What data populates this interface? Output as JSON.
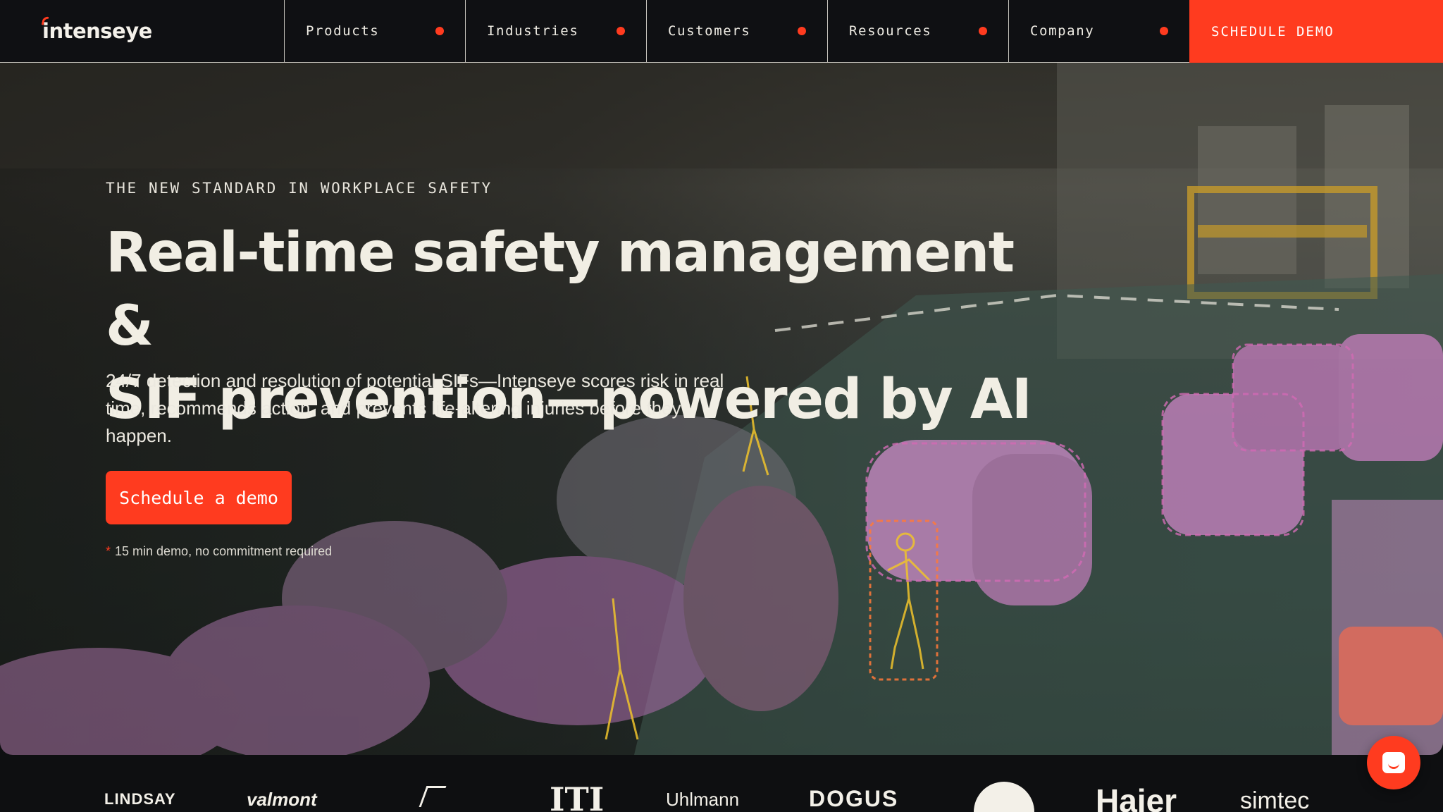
{
  "brand": {
    "logo_text": "intenseye"
  },
  "nav": {
    "items": [
      {
        "label": "Products"
      },
      {
        "label": "Industries"
      },
      {
        "label": "Customers"
      },
      {
        "label": "Resources"
      },
      {
        "label": "Company"
      }
    ],
    "cta_label": "SCHEDULE DEMO"
  },
  "hero": {
    "eyebrow": "THE NEW STANDARD IN WORKPLACE SAFETY",
    "headline_line1": "Real-time safety management &",
    "headline_line2": "SIF prevention—powered by AI",
    "subcopy": "24/7 detection and resolution of potential SIFs—Intenseye scores risk in real time, recommends action, and prevents life-altering injuries before they happen.",
    "cta_label": "Schedule a demo",
    "note_asterisk": "*",
    "note_text": "15 min demo, no commitment required"
  },
  "clients": [
    "LINDSAY",
    "valmont",
    "ITI",
    "Uhlmann",
    "DOGUS",
    "Haier",
    "simtec"
  ],
  "colors": {
    "accent": "#ff3b1f",
    "nav_bg": "#0f1013",
    "text": "#f1eee4"
  },
  "icons": {
    "chat": "chat-bubble-icon",
    "nav_indicator": "dot-icon"
  }
}
